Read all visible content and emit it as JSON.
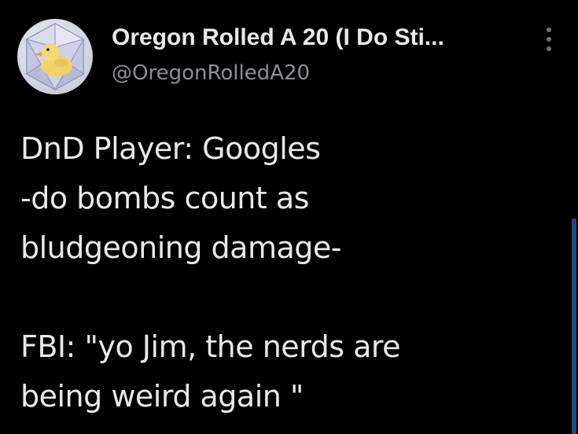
{
  "tweet": {
    "display_name": "Oregon Rolled A 20 (I Do Sti...",
    "handle": "@OregonRolledA20",
    "avatar_icon": "rubber-duck-d20-icon",
    "menu_icon": "more-vertical-icon",
    "lines": [
      "DnD Player: Googles",
      "-do bombs count as",
      "bludgeoning damage-",
      "",
      "FBI: \"yo Jim, the nerds are",
      "being weird again \""
    ]
  },
  "colors": {
    "background": "#000000",
    "text": "#e7e9ea",
    "secondary_text": "#8b9096",
    "scrollbar": "#1d4b82"
  }
}
